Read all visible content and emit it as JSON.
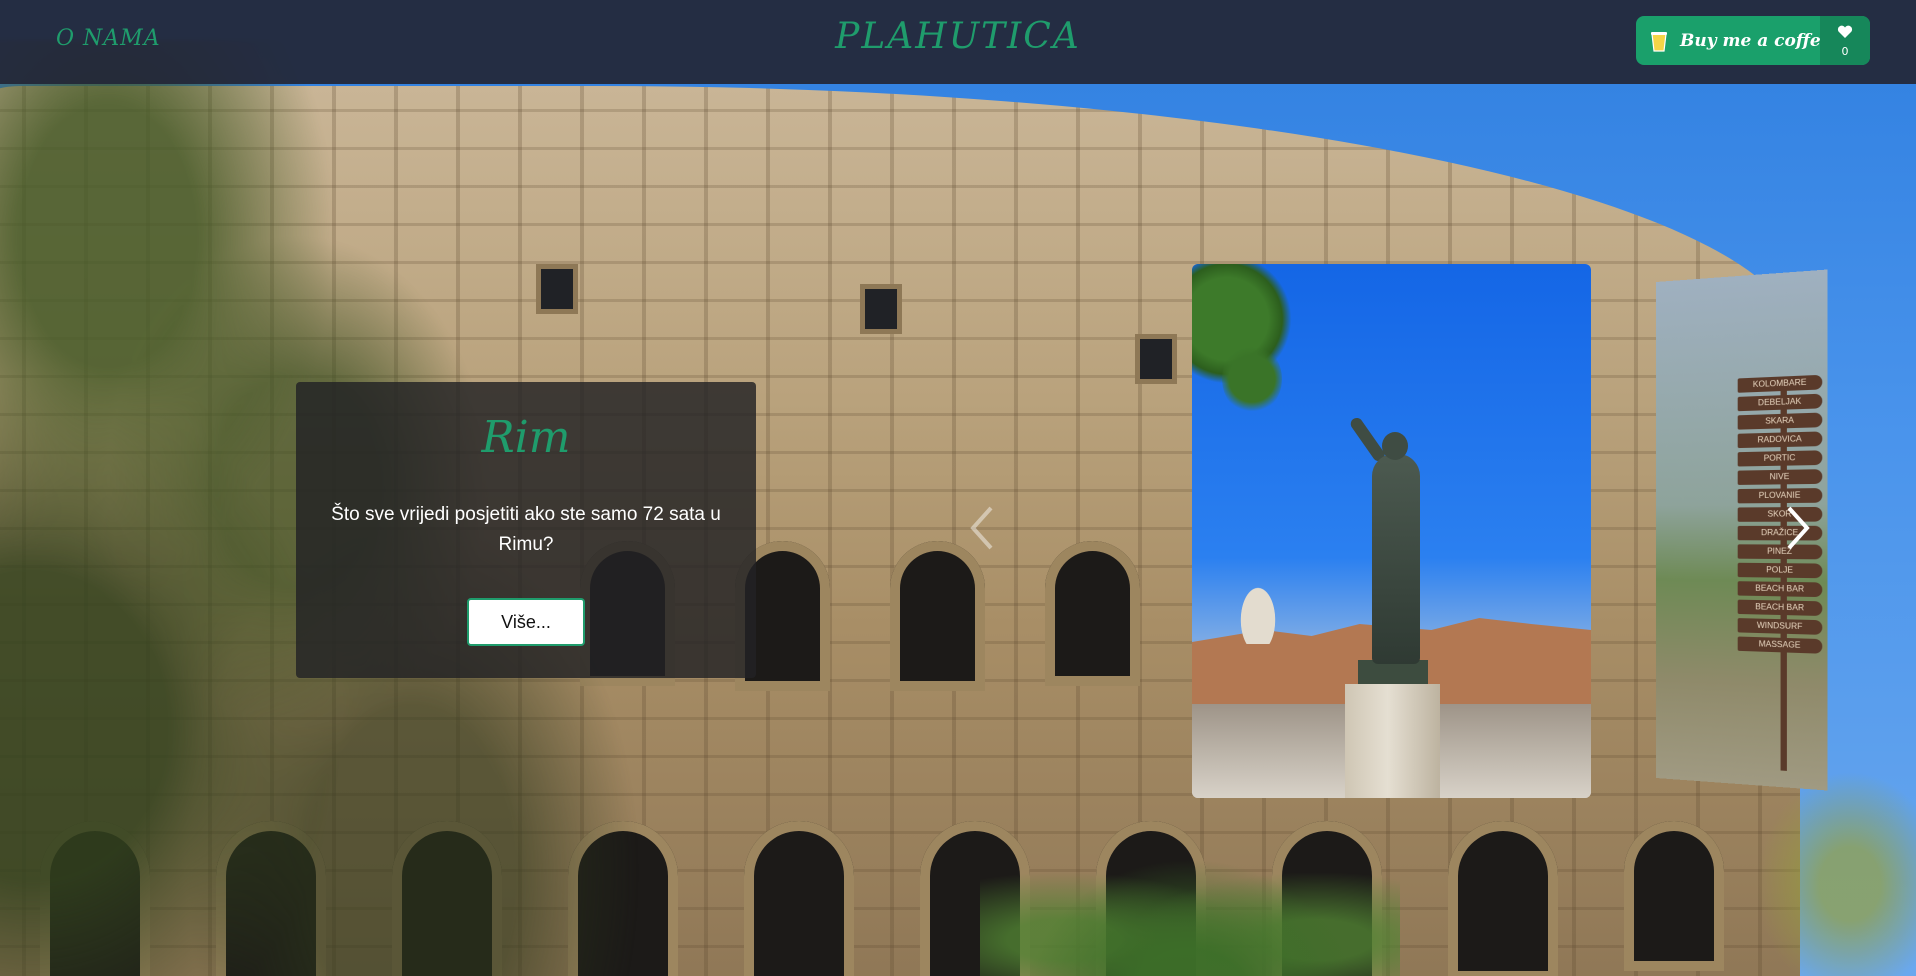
{
  "nav": {
    "about_label": "O NAMA",
    "brand": "PLAHUTICA",
    "coffee_label": "Buy me a coffee",
    "coffee_count": "0"
  },
  "slide": {
    "title": "Rim",
    "text": "Što sve vrijedi posjetiti ako ste samo 72 sata u Rimu?",
    "button_label": "Više..."
  },
  "signs": [
    "KOLOMBARE",
    "DEBELJAK",
    "SKARA",
    "RADOVICA",
    "PORTIC",
    "NIVE",
    "PLOVANIE",
    "SKOR",
    "DRAŽICE",
    "PINEZ",
    "POLJE",
    "BEACH BAR",
    "BEACH BAR",
    "WINDSURF",
    "MASSAGE"
  ],
  "colors": {
    "accent": "#1f9c6c",
    "navbar": "#232737",
    "coffee_button": "#1aa06b"
  },
  "icons": {
    "coffee": "coffee-cup-icon",
    "heart": "heart-icon",
    "prev": "chevron-left-icon",
    "next": "chevron-right-icon"
  }
}
